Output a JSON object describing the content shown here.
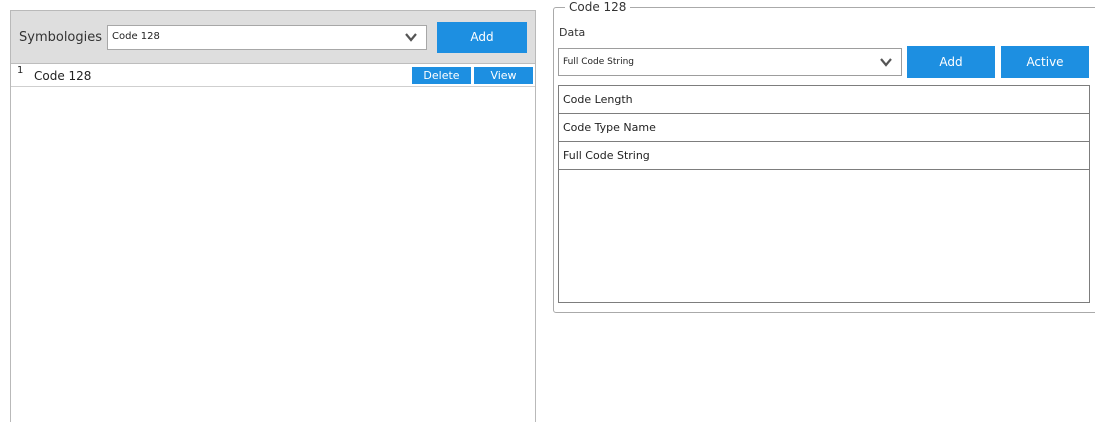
{
  "symbologies": {
    "label": "Symbologies",
    "selected": "Code 128",
    "add_label": "Add",
    "rows": [
      {
        "index": "1",
        "name": "Code 128",
        "delete_label": "Delete",
        "view_label": "View"
      }
    ]
  },
  "code_panel": {
    "legend": "Code 128",
    "data_label": "Data",
    "selected": "Full Code String",
    "add_label": "Add",
    "active_label": "Active",
    "items": [
      "Code Length",
      "Code Type Name",
      "Full Code String"
    ]
  },
  "colors": {
    "accent": "#1d8fe1",
    "toolbar_bg": "#dedede"
  },
  "icons": {
    "dropdown": "chevron-down-icon"
  }
}
